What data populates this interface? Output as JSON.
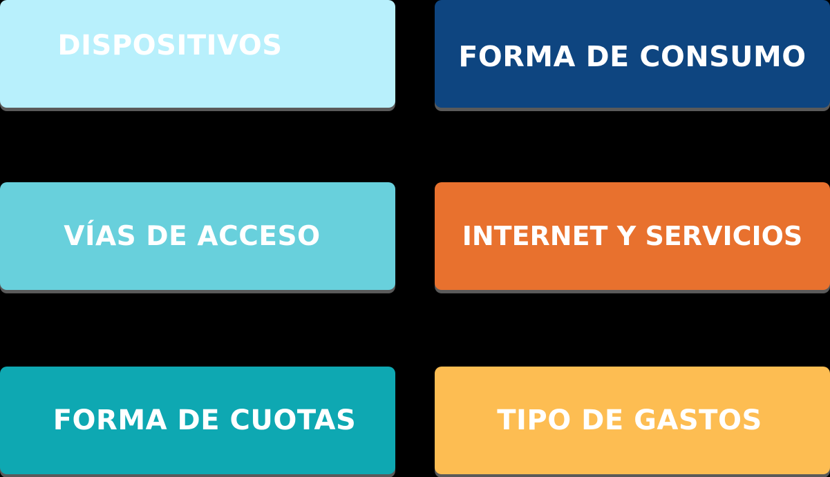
{
  "tiles": [
    {
      "id": "dispositivos",
      "label": "DISPOSITIVOS",
      "color": "#b8f0fc"
    },
    {
      "id": "forma-consumo",
      "label": "FORMA DE CONSUMO",
      "color": "#0e4580"
    },
    {
      "id": "vias-acceso",
      "label": "VÍAS DE ACCESO",
      "color": "#68d0dc"
    },
    {
      "id": "internet-servicios",
      "label": "INTERNET Y SERVICIOS",
      "color": "#e8712e"
    },
    {
      "id": "forma-cuotas",
      "label": "FORMA DE CUOTAS",
      "color": "#0ea8b2"
    },
    {
      "id": "tipo-gastos",
      "label": "TIPO DE GASTOS",
      "color": "#fdbd52"
    }
  ]
}
